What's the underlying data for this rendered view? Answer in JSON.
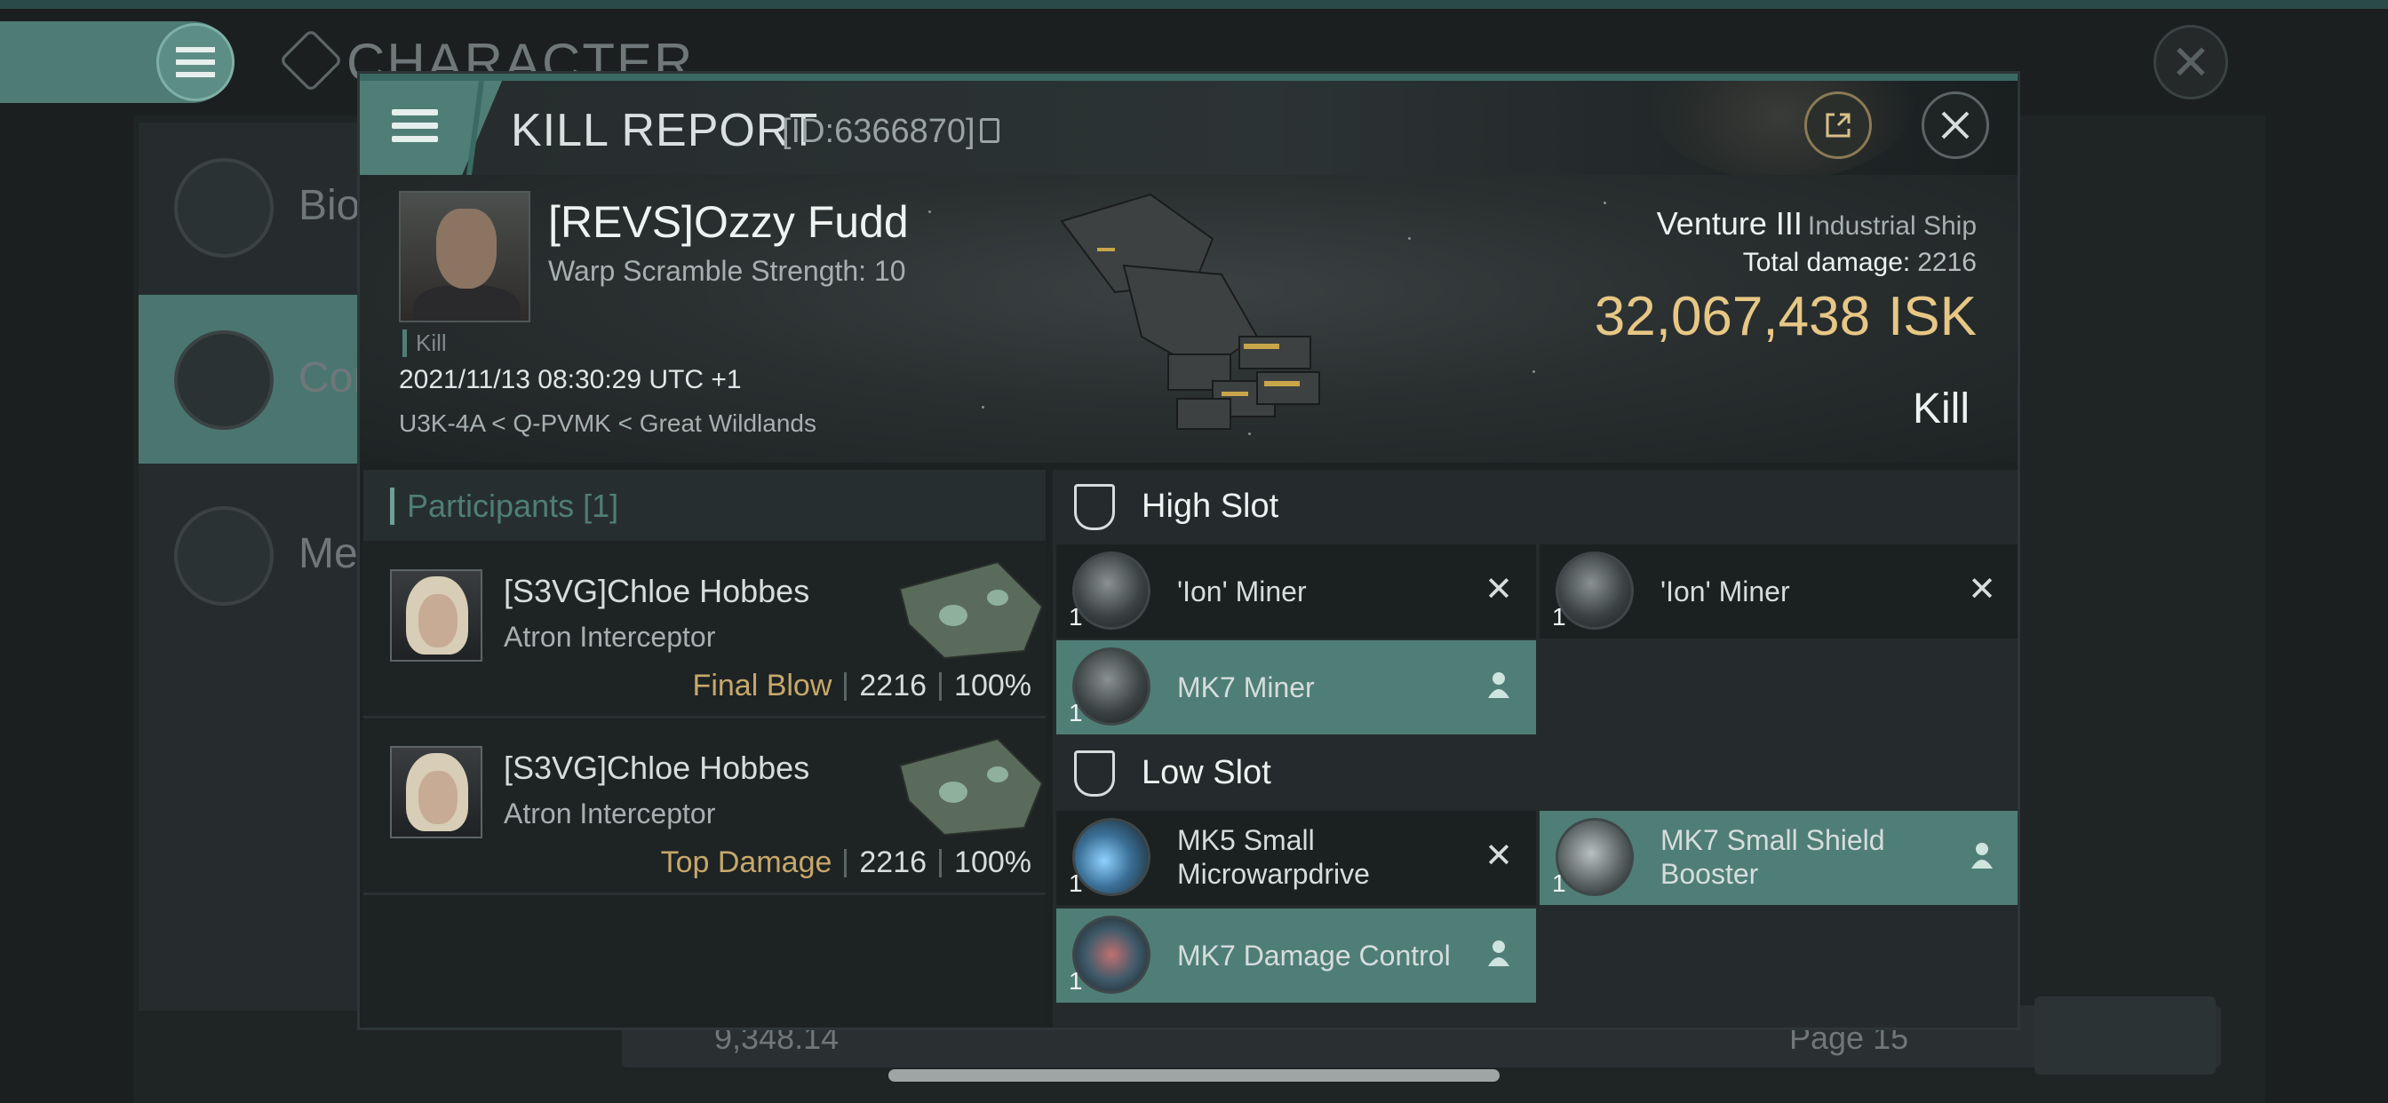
{
  "background": {
    "title": "CHARACTER",
    "side_items": [
      "Bio",
      "Con",
      "Med"
    ],
    "isk_balance": "9,348.14",
    "page_label": "Page 15"
  },
  "modal": {
    "title": "KILL REPORT",
    "id_label": "[ID:6366870]",
    "victim": {
      "name": "[REVS]Ozzy Fudd",
      "warp_scramble": "Warp Scramble Strength: 10",
      "kill_tag": "Kill",
      "datetime": "2021/11/13 08:30:29 UTC +1",
      "location": "U3K-4A < Q-PVMK < Great Wildlands"
    },
    "ship": {
      "name": "Venture III",
      "class": "Industrial Ship",
      "total_damage_label": "Total damage:",
      "total_damage": "2216",
      "isk_value": "32,067,438",
      "isk_unit": "ISK",
      "result": "Kill"
    },
    "participants": {
      "label": "Participants [1]",
      "rows": [
        {
          "name": "[S3VG]Chloe Hobbes",
          "ship": "Atron Interceptor",
          "role": "Final Blow",
          "damage": "2216",
          "percent": "100%"
        },
        {
          "name": "[S3VG]Chloe Hobbes",
          "ship": "Atron Interceptor",
          "role": "Top Damage",
          "damage": "2216",
          "percent": "100%"
        }
      ]
    },
    "fitting": {
      "high_slot": {
        "label": "High Slot",
        "modules": [
          {
            "name": "'Ion' Miner",
            "qty": "1",
            "status": "destroyed"
          },
          {
            "name": "'Ion' Miner",
            "qty": "1",
            "status": "destroyed"
          },
          {
            "name": "MK7 Miner",
            "qty": "1",
            "status": "dropped"
          }
        ]
      },
      "low_slot": {
        "label": "Low Slot",
        "modules": [
          {
            "name": "MK5 Small Microwarpdrive",
            "qty": "1",
            "status": "destroyed"
          },
          {
            "name": "MK7 Small Shield Booster",
            "qty": "1",
            "status": "dropped"
          },
          {
            "name": "MK7 Damage Control",
            "qty": "1",
            "status": "dropped"
          }
        ]
      }
    }
  },
  "colors": {
    "accent_teal": "#4f7e76",
    "isk_gold": "#e7c785",
    "role_gold": "#c7a86a"
  },
  "icons": [
    "menu-icon",
    "copy-icon",
    "share-icon",
    "close-icon",
    "high-slot-icon",
    "low-slot-icon",
    "destroyed-x-icon",
    "dropped-person-icon"
  ]
}
